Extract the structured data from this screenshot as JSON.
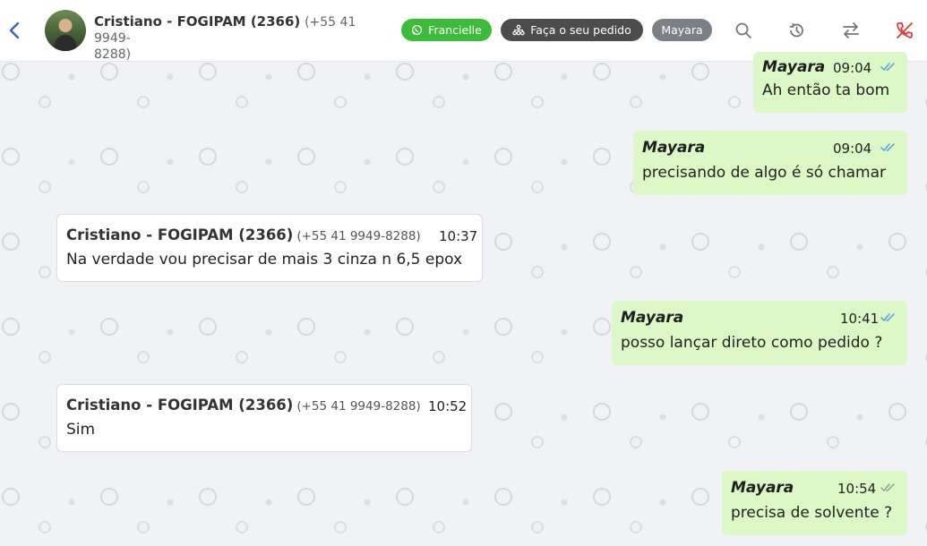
{
  "header": {
    "contact_name": "Cristiano - FOGIPAM (2366)",
    "contact_phone_line1": "(+55 41 9949-",
    "contact_phone_line2": "8288)",
    "tags": [
      {
        "label": "Francielle",
        "icon": "whatsapp-icon",
        "color": "#3dbb3a"
      },
      {
        "label": "Faça o seu pedido",
        "icon": "flow-icon",
        "color": "#4c4c4e"
      },
      {
        "label": "Mayara",
        "color": "#7b7f86"
      }
    ],
    "actions": [
      "search-icon",
      "history-icon",
      "transfer-icon",
      "end-call-icon"
    ]
  },
  "messages": [
    {
      "direction": "out",
      "sender": "Mayara",
      "time": "09:04",
      "text": "Ah então ta bom",
      "status": "read"
    },
    {
      "direction": "out",
      "sender": "Mayara",
      "time": "09:04",
      "text": "precisando de algo é só chamar",
      "status": "read"
    },
    {
      "direction": "in",
      "sender": "Cristiano - FOGIPAM (2366)",
      "phone": "(+55 41 9949-8288)",
      "time": "10:37",
      "text": "Na verdade vou precisar de mais 3 cinza n 6,5 epox"
    },
    {
      "direction": "out",
      "sender": "Mayara",
      "time": "10:41",
      "text": "posso lançar direto como pedido ?",
      "status": "read"
    },
    {
      "direction": "in",
      "sender": "Cristiano - FOGIPAM (2366)",
      "phone": "(+55 41 9949-8288)",
      "time": "10:52",
      "text": "Sim"
    },
    {
      "direction": "out",
      "sender": "Mayara",
      "time": "10:54",
      "text": "precisa de solvente ?",
      "status": "delivered"
    }
  ],
  "colors": {
    "outgoing_bubble": "#dcf8c6",
    "incoming_bubble": "#ffffff",
    "read_ticks": "#4fa3e3",
    "delivered_ticks": "#9a9a9a",
    "end_call": "#e53935"
  }
}
